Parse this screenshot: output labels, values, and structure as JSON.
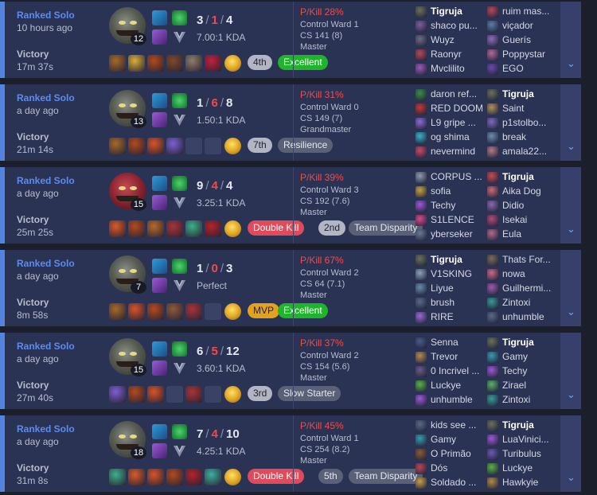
{
  "matches": [
    {
      "queue": "Ranked Solo",
      "time_ago": "10 hours ago",
      "result": "Victory",
      "duration": "17m 37s",
      "champion_level": "12",
      "champion_look": "grey",
      "kills": "3",
      "deaths": "1",
      "assists": "4",
      "kda_ratio": "7.00:1 KDA",
      "items": [
        "#a56a2a",
        "#d8b03a",
        "#b14a1f",
        "#7d4a2a",
        "#8c7e6a",
        "#c41f3d"
      ],
      "badges": [
        {
          "text": "4th",
          "color": "grey"
        },
        {
          "text": "Excellent",
          "color": "green"
        }
      ],
      "p_kill": "P/Kill 28%",
      "control_ward": "Control Ward 1",
      "cs": "CS 141 (8)",
      "rank": "Master",
      "team1": [
        {
          "name": "Tigruja",
          "me": true,
          "pic": "#6a705e"
        },
        {
          "name": "shaco pu...",
          "pic": "#7b5fa4"
        },
        {
          "name": "Wuyz",
          "pic": "#6b6b8a"
        },
        {
          "name": "Raonyr",
          "pic": "#b34a5d"
        },
        {
          "name": "Mvclilito",
          "pic": "#9c5ab8"
        }
      ],
      "team2": [
        {
          "name": "ruim mas...",
          "pic": "#b3485e"
        },
        {
          "name": "viçador",
          "pic": "#5d7ba8"
        },
        {
          "name": "Guerís",
          "pic": "#8c6cba"
        },
        {
          "name": "Poppystar",
          "pic": "#b06a9e"
        },
        {
          "name": "EGO",
          "pic": "#6a4ab0"
        }
      ]
    },
    {
      "queue": "Ranked Solo",
      "time_ago": "a day ago",
      "result": "Victory",
      "duration": "21m 14s",
      "champion_level": "13",
      "champion_look": "grey",
      "kills": "1",
      "deaths": "6",
      "assists": "8",
      "kda_ratio": "1.50:1 KDA",
      "items": [
        "#a56a2a",
        "#b34a1f",
        "#d8542a",
        "#7b5fd6",
        "",
        ""
      ],
      "badges": [
        {
          "text": "7th",
          "color": "grey"
        },
        {
          "text": "Resilience",
          "color": "grey"
        }
      ],
      "p_kill": "P/Kill 31%",
      "control_ward": "Control Ward 0",
      "cs": "CS 149 (7)",
      "rank": "Grandmaster",
      "team1": [
        {
          "name": "daron ref...",
          "pic": "#3d8c4a"
        },
        {
          "name": "RED DOOM",
          "pic": "#c23a3a"
        },
        {
          "name": "L9 gripe ...",
          "pic": "#8c6ad6"
        },
        {
          "name": "og shima",
          "pic": "#3ab0c8"
        },
        {
          "name": "nevermind",
          "pic": "#c84a6a"
        }
      ],
      "team2": [
        {
          "name": "Tigruja",
          "me": true,
          "pic": "#6a705e"
        },
        {
          "name": "Saint",
          "pic": "#b09060"
        },
        {
          "name": "p1stolbo...",
          "pic": "#7a6ac0"
        },
        {
          "name": "break",
          "pic": "#6a8cb0"
        },
        {
          "name": "amala22...",
          "pic": "#b07a8c"
        }
      ]
    },
    {
      "queue": "Ranked Solo",
      "time_ago": "a day ago",
      "result": "Victory",
      "duration": "25m 25s",
      "champion_level": "15",
      "champion_look": "red",
      "kills": "9",
      "deaths": "4",
      "assists": "4",
      "kda_ratio": "3.25:1 KDA",
      "items": [
        "#d85a2a",
        "#b34a1f",
        "#b86a2a",
        "#a8343a",
        "#3ab08c",
        "#b3222a"
      ],
      "badges": [
        {
          "text": "Double Kill",
          "color": "red"
        },
        {
          "text": "2nd",
          "color": "light"
        },
        {
          "text": "Team Disparity",
          "color": "grey"
        }
      ],
      "p_kill": "P/Kill 39%",
      "control_ward": "Control Ward 3",
      "cs": "CS 192 (7.6)",
      "rank": "Master",
      "team1": [
        {
          "name": "CORPUS ...",
          "pic": "#8c9ab0"
        },
        {
          "name": "sofia",
          "pic": "#c8a048"
        },
        {
          "name": "Techy",
          "pic": "#9a5ad6"
        },
        {
          "name": "S1LENCE",
          "pic": "#d64a8c"
        },
        {
          "name": "yberseker",
          "pic": "#6a7a9a"
        }
      ],
      "team2": [
        {
          "name": "Tigruja",
          "me": true,
          "pic": "#c84a52"
        },
        {
          "name": "Aika Dog",
          "pic": "#c86a7a"
        },
        {
          "name": "Didio",
          "pic": "#8a6ab0"
        },
        {
          "name": "Isekai",
          "pic": "#b04a7a"
        },
        {
          "name": "Eula",
          "pic": "#b06a8c"
        }
      ]
    },
    {
      "queue": "Ranked Solo",
      "time_ago": "a day ago",
      "result": "Victory",
      "duration": "8m 58s",
      "champion_level": "7",
      "champion_look": "grey",
      "kills": "1",
      "deaths": "0",
      "assists": "3",
      "kda_ratio": "Perfect",
      "items": [
        "#a56a2a",
        "#d8542a",
        "#b34a1f",
        "#8c5a3a",
        "#a8343a",
        ""
      ],
      "badges": [
        {
          "text": "MVP",
          "color": "gold"
        },
        {
          "text": "Excellent",
          "color": "green"
        }
      ],
      "p_kill": "P/Kill 67%",
      "control_ward": "Control Ward 2",
      "cs": "CS 64 (7.1)",
      "rank": "Master",
      "team1": [
        {
          "name": "Tigruja",
          "me": true,
          "pic": "#6a705e"
        },
        {
          "name": "V1SKING",
          "pic": "#8ca0c0"
        },
        {
          "name": "Liyue",
          "pic": "#6a8ab0"
        },
        {
          "name": "brush",
          "pic": "#5a6a8a"
        },
        {
          "name": "RIRE",
          "pic": "#9a6ad6"
        }
      ],
      "team2": [
        {
          "name": "Thats For...",
          "pic": "#7a6a5a"
        },
        {
          "name": "nowa",
          "pic": "#c86a8c"
        },
        {
          "name": "Guilhermi...",
          "pic": "#9a5ab0"
        },
        {
          "name": "Zintoxi",
          "pic": "#3a9a9a"
        },
        {
          "name": "unhumble",
          "pic": "#5a6a8a"
        }
      ]
    },
    {
      "queue": "Ranked Solo",
      "time_ago": "a day ago",
      "result": "Victory",
      "duration": "27m 40s",
      "champion_level": "15",
      "champion_look": "grey",
      "kills": "6",
      "deaths": "5",
      "assists": "12",
      "kda_ratio": "3.60:1 KDA",
      "items": [
        "#7b5fd6",
        "#b34a1f",
        "#d8542a",
        "",
        "#a8343a",
        ""
      ],
      "badges": [
        {
          "text": "3rd",
          "color": "grey"
        },
        {
          "text": "Slow Starter",
          "color": "grey"
        }
      ],
      "p_kill": "P/Kill 37%",
      "control_ward": "Control Ward 2",
      "cs": "CS 154 (5.6)",
      "rank": "Master",
      "team1": [
        {
          "name": "Senna",
          "pic": "#4a5a8a"
        },
        {
          "name": "Trevor",
          "pic": "#b08a5a"
        },
        {
          "name": "0 Incrivel ...",
          "pic": "#6a5a8a"
        },
        {
          "name": "Luckye",
          "pic": "#5ab04a"
        },
        {
          "name": "unhumble",
          "pic": "#9a5ad6"
        }
      ],
      "team2": [
        {
          "name": "Tigruja",
          "me": true,
          "pic": "#6a705e"
        },
        {
          "name": "Gamy",
          "pic": "#3a9ab0"
        },
        {
          "name": "Techy",
          "pic": "#9a5ad6"
        },
        {
          "name": "Zirael",
          "pic": "#5ab06a"
        },
        {
          "name": "Zintoxi",
          "pic": "#3a9a9a"
        }
      ]
    },
    {
      "queue": "Ranked Solo",
      "time_ago": "a day ago",
      "result": "Victory",
      "duration": "31m 8s",
      "champion_level": "18",
      "champion_look": "grey",
      "kills": "7",
      "deaths": "4",
      "assists": "10",
      "kda_ratio": "4.25:1 KDA",
      "items": [
        "#3ab08c",
        "#d85a2a",
        "#d8542a",
        "#b34a1f",
        "#b3222a",
        "#3ab0a0"
      ],
      "badges": [
        {
          "text": "Double Kill",
          "color": "red"
        },
        {
          "text": "5th",
          "color": "grey"
        },
        {
          "text": "Team Disparity",
          "color": "grey"
        }
      ],
      "p_kill": "P/Kill 45%",
      "control_ward": "Control Ward 1",
      "cs": "CS 254 (8.2)",
      "rank": "Master",
      "team1": [
        {
          "name": "kids see ...",
          "pic": "#5a6a8a"
        },
        {
          "name": "Gamy",
          "pic": "#3a9ab0"
        },
        {
          "name": "O Primão",
          "pic": "#8a5a3a"
        },
        {
          "name": "Dós",
          "pic": "#b04a5a"
        },
        {
          "name": "Soldado ...",
          "pic": "#c8a048"
        }
      ],
      "team2": [
        {
          "name": "Tigruja",
          "me": true,
          "pic": "#6a705e"
        },
        {
          "name": "LuaVinici...",
          "pic": "#9a5ad6"
        },
        {
          "name": "Turibulus",
          "pic": "#6a5ab0"
        },
        {
          "name": "Luckye",
          "pic": "#5ab04a"
        },
        {
          "name": "Hawkyie",
          "pic": "#b08a4a"
        }
      ]
    }
  ],
  "colors": {
    "accent": "#5584e0",
    "card": "#2b3354",
    "deaths": "#ef4b4b",
    "excellent": "#1fb52b",
    "mvp": "#e3a21d",
    "double_kill": "#e14a5a"
  },
  "icons": {
    "expand": "chevron-down-icon",
    "spell1": "flash-icon",
    "spell2": "rune-icon",
    "spell3": "secondary-rune-icon",
    "rank": "master-emblem-icon",
    "trinket": "warding-totem-icon"
  }
}
